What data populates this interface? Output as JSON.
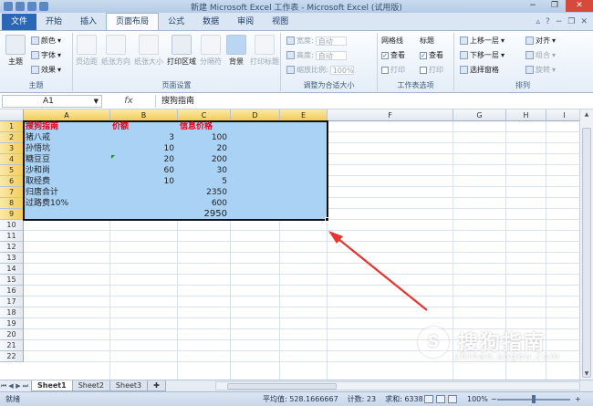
{
  "window": {
    "title": "新建 Microsoft Excel 工作表 - Microsoft Excel (试用版)",
    "controls": {
      "minimize": "−",
      "restore": "❐",
      "close": "✕"
    }
  },
  "tabs": [
    "文件",
    "开始",
    "插入",
    "页面布局",
    "公式",
    "数据",
    "审阅",
    "视图"
  ],
  "active_tab": "页面布局",
  "ribbon": {
    "theme": {
      "label": "主题",
      "main": "主题",
      "colors": "颜色",
      "fonts": "字体",
      "effects": "效果"
    },
    "page_setup": {
      "label": "页面设置",
      "margins": "页边距",
      "orientation": "纸张方向",
      "size": "纸张大小",
      "print_area": "打印区域",
      "breaks": "分隔符",
      "background": "背景",
      "print_titles": "打印标题"
    },
    "scale": {
      "label": "调整为合适大小",
      "width": "宽度:",
      "height": "高度:",
      "scale": "缩放比例:",
      "width_val": "自动",
      "height_val": "自动",
      "scale_val": "100%"
    },
    "sheet_options": {
      "label": "工作表选项",
      "gridlines": "网格线",
      "headings": "标题",
      "view": "查看",
      "print": "打印"
    },
    "arrange": {
      "label": "排列",
      "bring_forward": "上移一层",
      "send_backward": "下移一层",
      "selection_pane": "选择窗格",
      "align": "对齐",
      "group": "组合",
      "rotate": "旋转"
    }
  },
  "formula_bar": {
    "name_box": "A1",
    "fx": "fx",
    "value": "搜狗指南"
  },
  "columns": [
    "A",
    "B",
    "C",
    "D",
    "E",
    "F",
    "G",
    "H",
    "I"
  ],
  "rows": [
    "1",
    "2",
    "3",
    "4",
    "5",
    "6",
    "7",
    "8",
    "9",
    "10",
    "11",
    "12",
    "13",
    "14",
    "15",
    "16",
    "17",
    "18",
    "19",
    "20",
    "21",
    "22"
  ],
  "cells": {
    "header": {
      "a": "搜狗指南",
      "b": "价额",
      "c": "信息价格"
    },
    "data": [
      {
        "a": "猪八戒",
        "b": "3",
        "c": "100"
      },
      {
        "a": "孙悟坑",
        "b": "10",
        "c": "20"
      },
      {
        "a": "糖豆豆",
        "b": "20",
        "c": "200"
      },
      {
        "a": "沙和尚",
        "b": "60",
        "c": "30"
      },
      {
        "a": "取经费",
        "b": "10",
        "c": "5"
      },
      {
        "a": "归唐合计",
        "b": "",
        "c": "2350"
      },
      {
        "a": "过路费10%",
        "b": "",
        "c": "600"
      },
      {
        "a": "",
        "b": "",
        "c": "2950"
      }
    ]
  },
  "sheets": [
    "Sheet1",
    "Sheet2",
    "Sheet3"
  ],
  "active_sheet": "Sheet1",
  "status": {
    "ready": "就绪",
    "average": "平均值: 528.1666667",
    "count": "计数: 23",
    "sum": "求和: 6338",
    "zoom": "100%",
    "minus": "−",
    "plus": "+"
  },
  "watermark": {
    "brand": "搜狗指南",
    "url": "zhinan.sogou.com",
    "logo": "S"
  },
  "colors": {
    "selection": "#a9d2f5",
    "header_text": "#e8001c",
    "arrow": "#e8352f",
    "file_tab": "#2b67b7"
  }
}
